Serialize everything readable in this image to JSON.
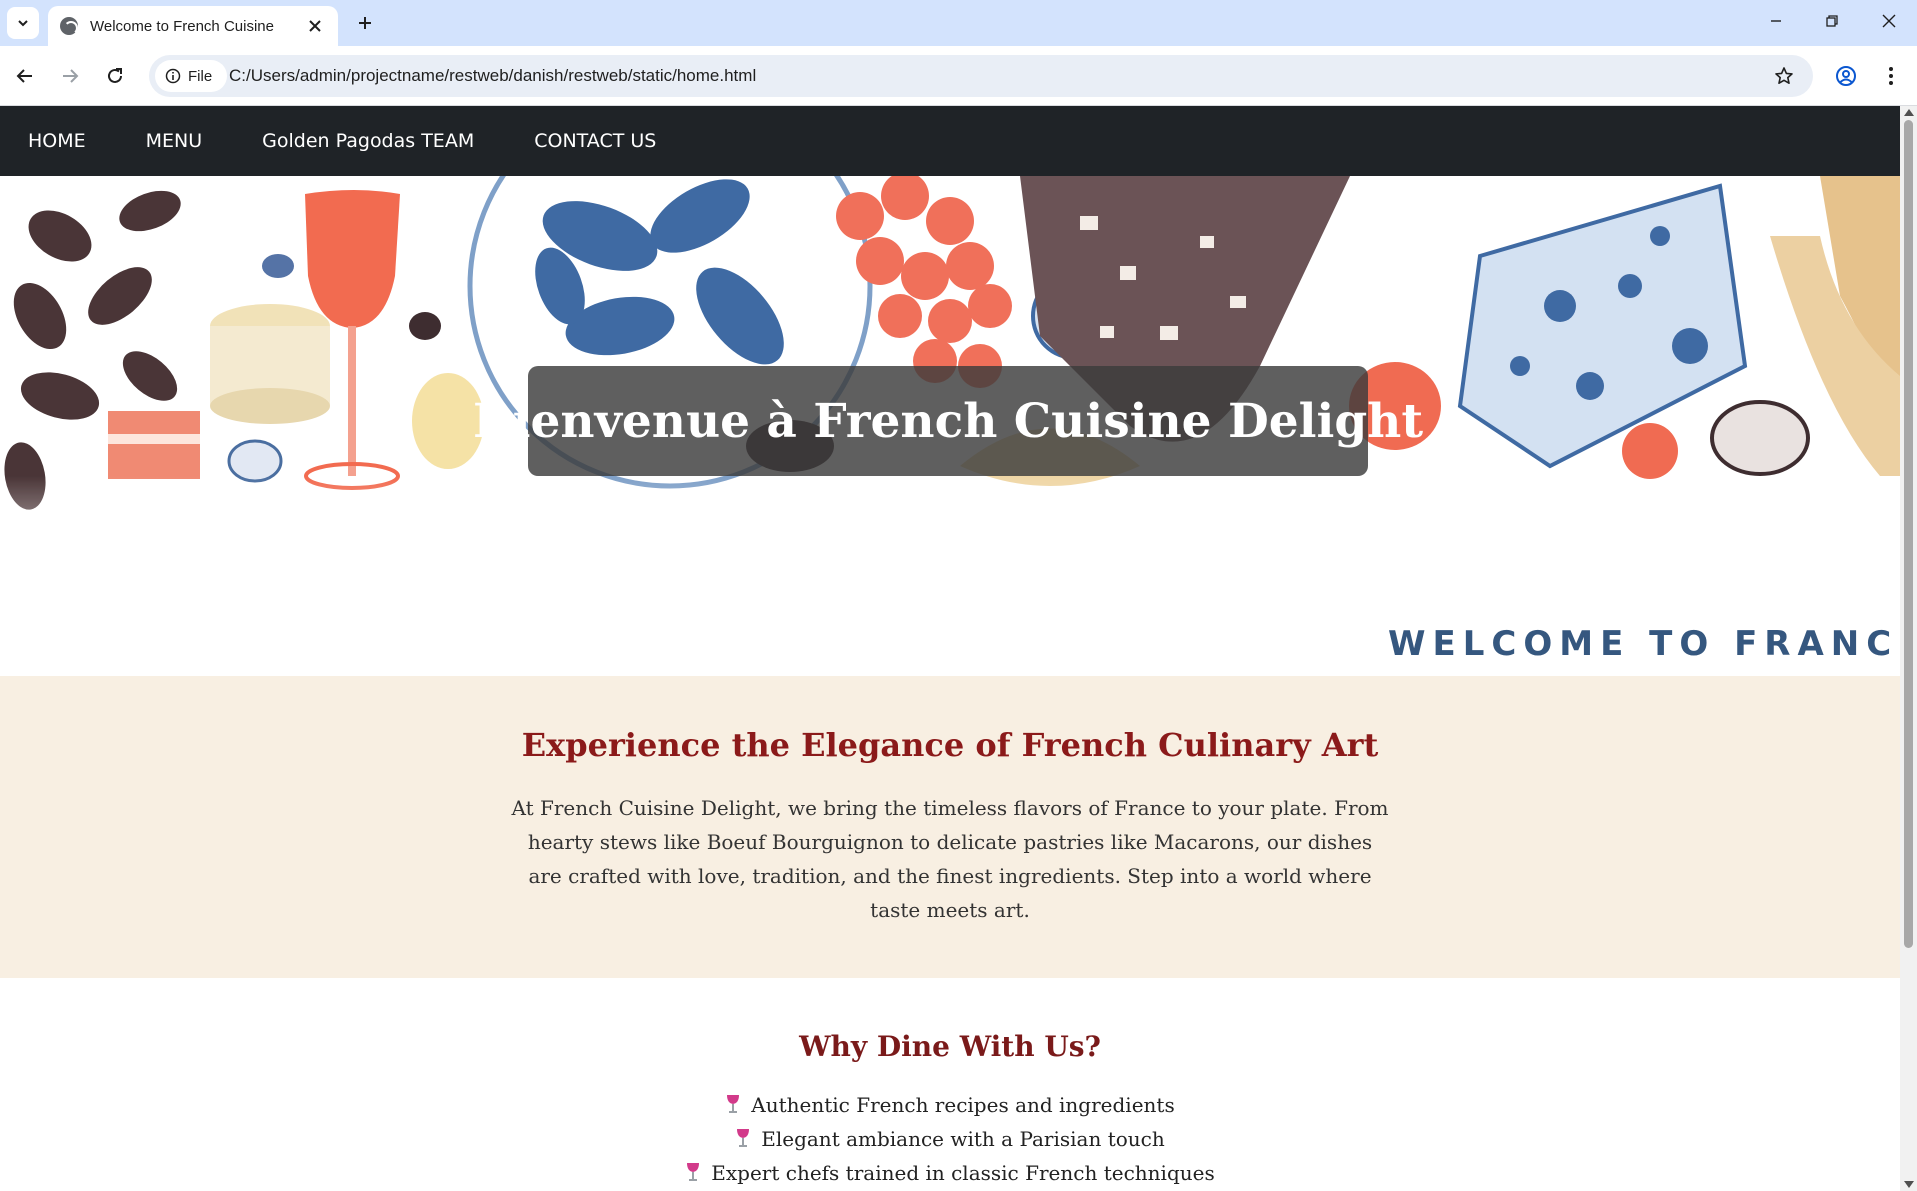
{
  "browser": {
    "tab_title": "Welcome to French Cuisine",
    "chip_label": "File",
    "url": "C:/Users/admin/projectname/restweb/danish/restweb/static/home.html"
  },
  "nav": {
    "items": [
      "HOME",
      "MENU",
      "Golden Pagodas TEAM",
      "CONTACT US"
    ]
  },
  "hero": {
    "title": "Bienvenue à French Cuisine Delight",
    "stamp": "WELCOME TO FRANCE"
  },
  "intro": {
    "heading": "Experience the Elegance of French Culinary Art",
    "paragraph": "At French Cuisine Delight, we bring the timeless flavors of France to your plate. From hearty stews like Boeuf Bourguignon to delicate pastries like Macarons, our dishes are crafted with love, tradition, and the finest ingredients. Step into a world where taste meets art."
  },
  "why": {
    "heading": "Why Dine With Us?",
    "items": [
      "Authentic French recipes and ingredients",
      "Elegant ambiance with a Parisian touch",
      "Expert chefs trained in classic French techniques"
    ]
  },
  "colors": {
    "nav_bg": "#1f2327",
    "intro_bg": "#f8efe2",
    "heading": "#8b1a1a",
    "stamp": "#35577f"
  }
}
